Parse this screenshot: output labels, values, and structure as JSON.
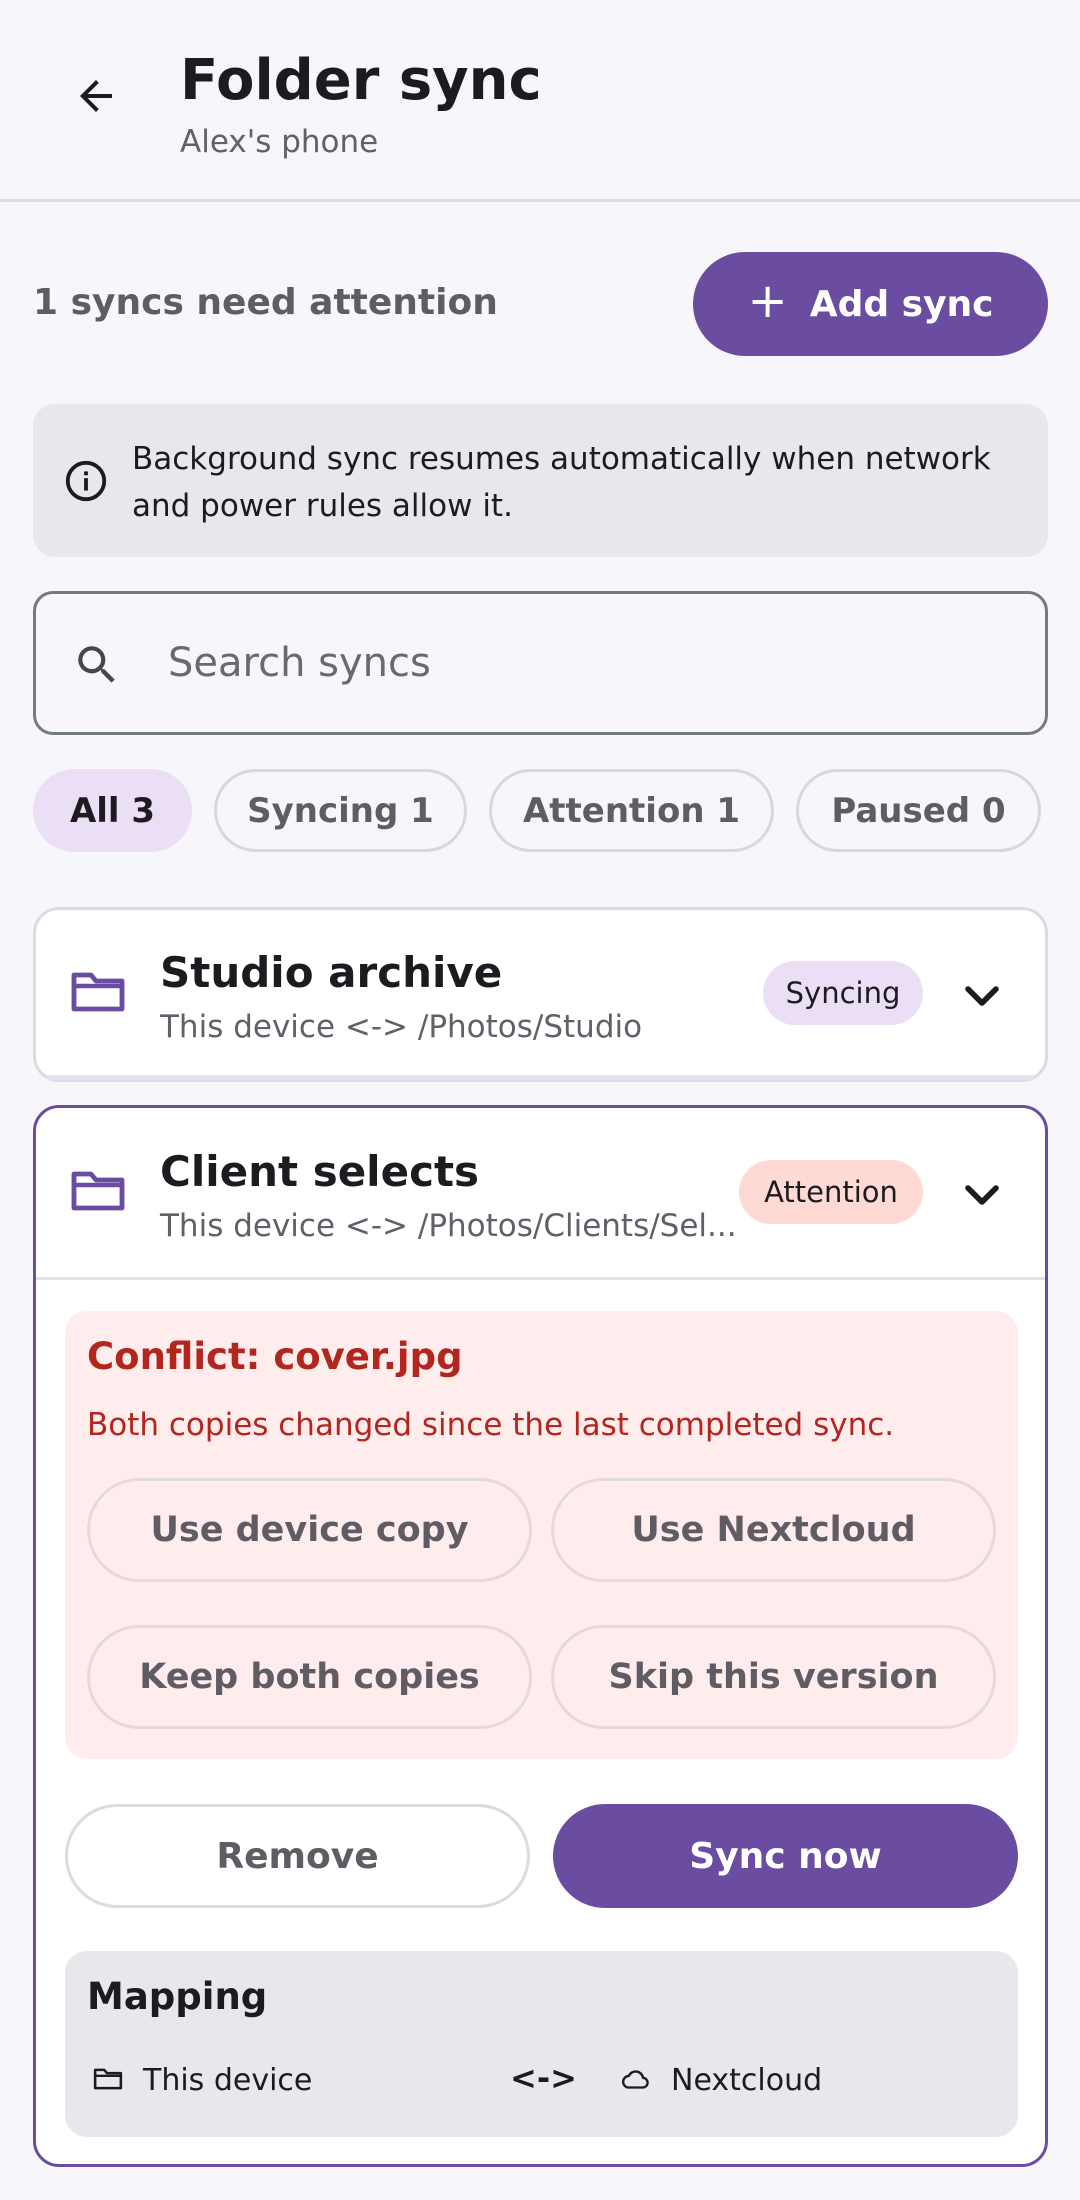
{
  "header": {
    "title": "Folder sync",
    "subtitle": "Alex's phone",
    "back_icon": "arrow-left-icon"
  },
  "toolbar": {
    "summary": "1 syncs need attention",
    "add_label": "Add sync",
    "add_icon": "+"
  },
  "banner": {
    "text": "Background sync resumes automatically when network and power rules allow it.",
    "icon": "info-icon"
  },
  "search": {
    "placeholder": "Search syncs",
    "value": "",
    "icon": "search-icon"
  },
  "filters": [
    {
      "label": "All 3",
      "selected": true
    },
    {
      "label": "Syncing 1",
      "selected": false
    },
    {
      "label": "Attention 1",
      "selected": false
    },
    {
      "label": "Paused 0",
      "selected": false
    }
  ],
  "syncs": [
    {
      "title": "Studio archive",
      "path": "This device <-> /Photos/Studio",
      "status": "Syncing",
      "status_color": "#ebdff5",
      "expanded": false
    },
    {
      "title": "Client selects",
      "path": "This device <-> /Photos/Clients/Sel...",
      "status": "Attention",
      "status_color": "#ffdad5",
      "expanded": true,
      "conflict": {
        "title": "Conflict: cover.jpg",
        "message": "Both copies changed since the last completed sync.",
        "options": [
          "Use device copy",
          "Use Nextcloud",
          "Keep both copies",
          "Skip this version"
        ]
      },
      "actions": {
        "remove": "Remove",
        "sync_now": "Sync now"
      },
      "mapping": {
        "title": "Mapping",
        "local": "This device",
        "separator": "<->",
        "remote": "Nextcloud"
      }
    }
  ],
  "colors": {
    "accent": "#6a4ca0",
    "error": "#b3261e",
    "background": "#f7f6fa"
  }
}
